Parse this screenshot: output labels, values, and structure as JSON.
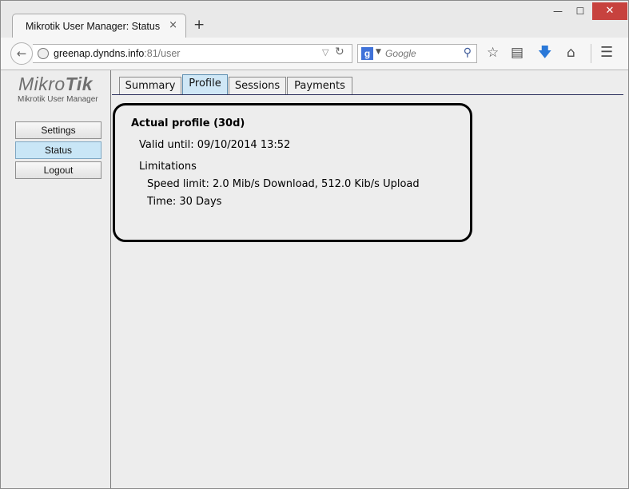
{
  "browser": {
    "tab_title": "Mikrotik User Manager: Status",
    "tab_close": "×",
    "new_tab": "+",
    "url_host": "greenap.dyndns.info",
    "url_path": ":81/user",
    "search_placeholder": "Google",
    "window_controls": {
      "minimize": "—",
      "maximize": "☐",
      "close": "✕"
    },
    "icons": [
      "back-arrow-icon",
      "globe-icon",
      "reload-icon",
      "google-icon",
      "search-icon",
      "bookmark-star-icon",
      "reading-list-icon",
      "download-icon",
      "home-icon",
      "menu-icon"
    ]
  },
  "sidebar": {
    "logo_light": "Mikro",
    "logo_bold": "Tik",
    "subtitle": "Mikrotik User Manager",
    "buttons": [
      {
        "label": "Settings",
        "active": false
      },
      {
        "label": "Status",
        "active": true
      },
      {
        "label": "Logout",
        "active": false
      }
    ]
  },
  "tabs": [
    {
      "label": "Summary",
      "active": false
    },
    {
      "label": "Profile",
      "active": true
    },
    {
      "label": "Sessions",
      "active": false
    },
    {
      "label": "Payments",
      "active": false
    }
  ],
  "profile": {
    "title": "Actual profile (30d)",
    "valid_until": "Valid until: 09/10/2014 13:52",
    "limitations_heading": "Limitations",
    "speed_limit": "Speed limit: 2.0 Mib/s Download, 512.0 Kib/s Upload",
    "time": "Time: 30 Days"
  },
  "colors": {
    "active_tab": "#cfe7f6",
    "active_button": "#c9e6f6",
    "window_close": "#c7423e",
    "tab_underline": "#2b2f5c"
  }
}
